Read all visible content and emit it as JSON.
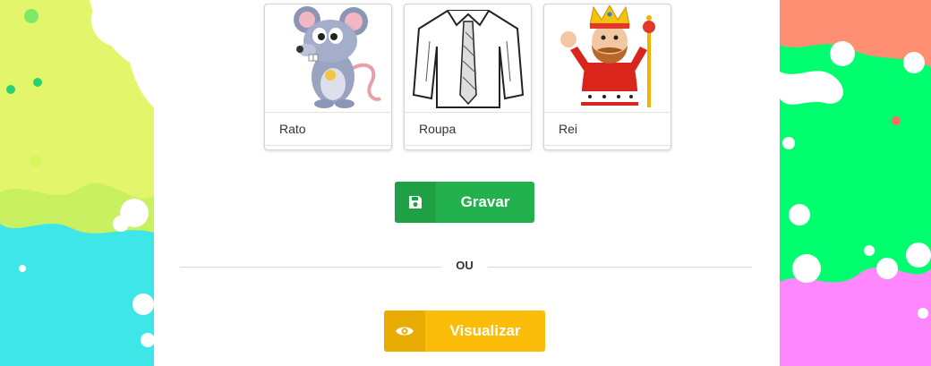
{
  "cards": [
    {
      "label": "Rato",
      "icon": "mouse-cartoon-icon"
    },
    {
      "label": "Roupa",
      "icon": "shirt-icon"
    },
    {
      "label": "Rei",
      "icon": "king-cartoon-icon"
    }
  ],
  "actions": {
    "save_label": "Gravar",
    "or_label": "OU",
    "view_label": "Visualizar"
  },
  "colors": {
    "save": "#22b14c",
    "view": "#fbbc0a",
    "splash_yellow": "#e3f56a",
    "splash_cyan": "#3fe6e8",
    "splash_salmon": "#ff8f72",
    "splash_green": "#00ff6e",
    "splash_pink": "#ff88ff"
  }
}
